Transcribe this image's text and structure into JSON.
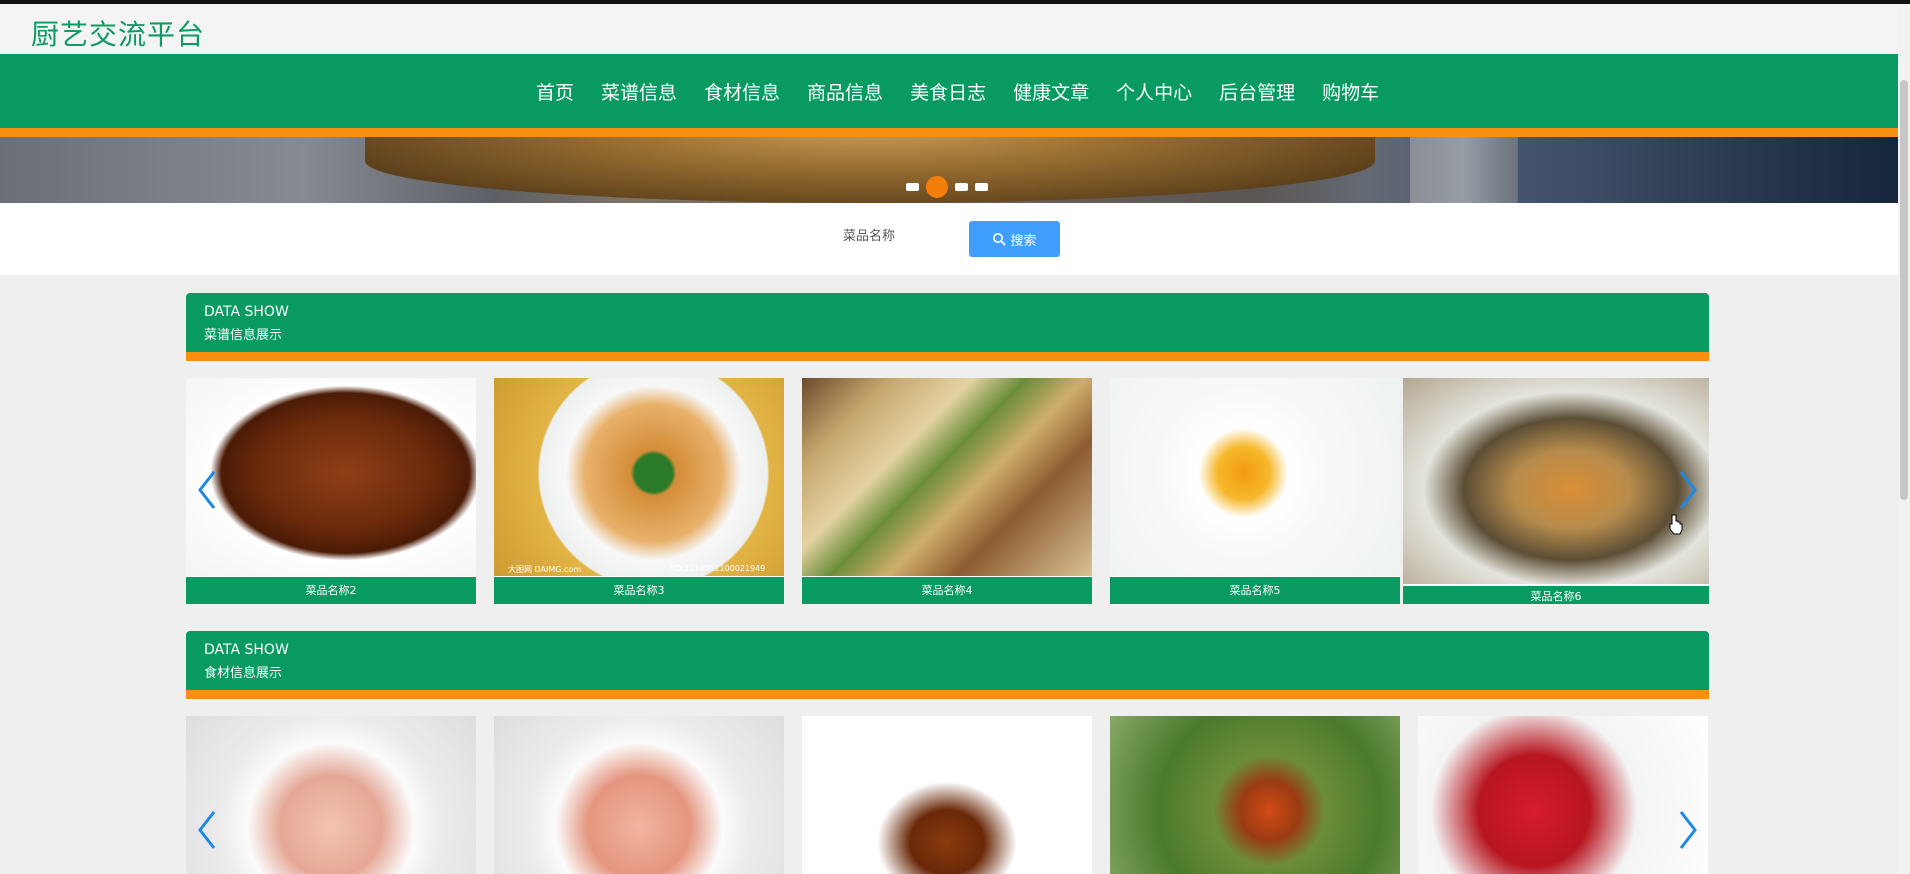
{
  "brand": {
    "title": "厨艺交流平台"
  },
  "nav": {
    "items": [
      "首页",
      "菜谱信息",
      "食材信息",
      "商品信息",
      "美食日志",
      "健康文章",
      "个人中心",
      "后台管理",
      "购物车"
    ]
  },
  "carousel": {
    "slide_count": 4,
    "active_index": 1
  },
  "search": {
    "label": "菜品名称",
    "button_label": "搜索"
  },
  "sections": [
    {
      "header_en": "DATA SHOW",
      "header_cn": "菜谱信息展示",
      "items": [
        {
          "name": "菜品名称2"
        },
        {
          "name": "菜品名称3",
          "watermark_left": "大图网 DAIMG.com",
          "watermark_right": "NO:20140811000219​49"
        },
        {
          "name": "菜品名称4"
        },
        {
          "name": "菜品名称5"
        },
        {
          "name": "菜品名称6"
        }
      ]
    },
    {
      "header_en": "DATA SHOW",
      "header_cn": "食材信息展示",
      "items": [
        {
          "name": ""
        },
        {
          "name": ""
        },
        {
          "name": ""
        },
        {
          "name": ""
        },
        {
          "name": ""
        }
      ]
    }
  ],
  "colors": {
    "primary": "#089a61",
    "accent": "#f98f11",
    "button": "#409eff",
    "arrow": "#1e88e5"
  }
}
